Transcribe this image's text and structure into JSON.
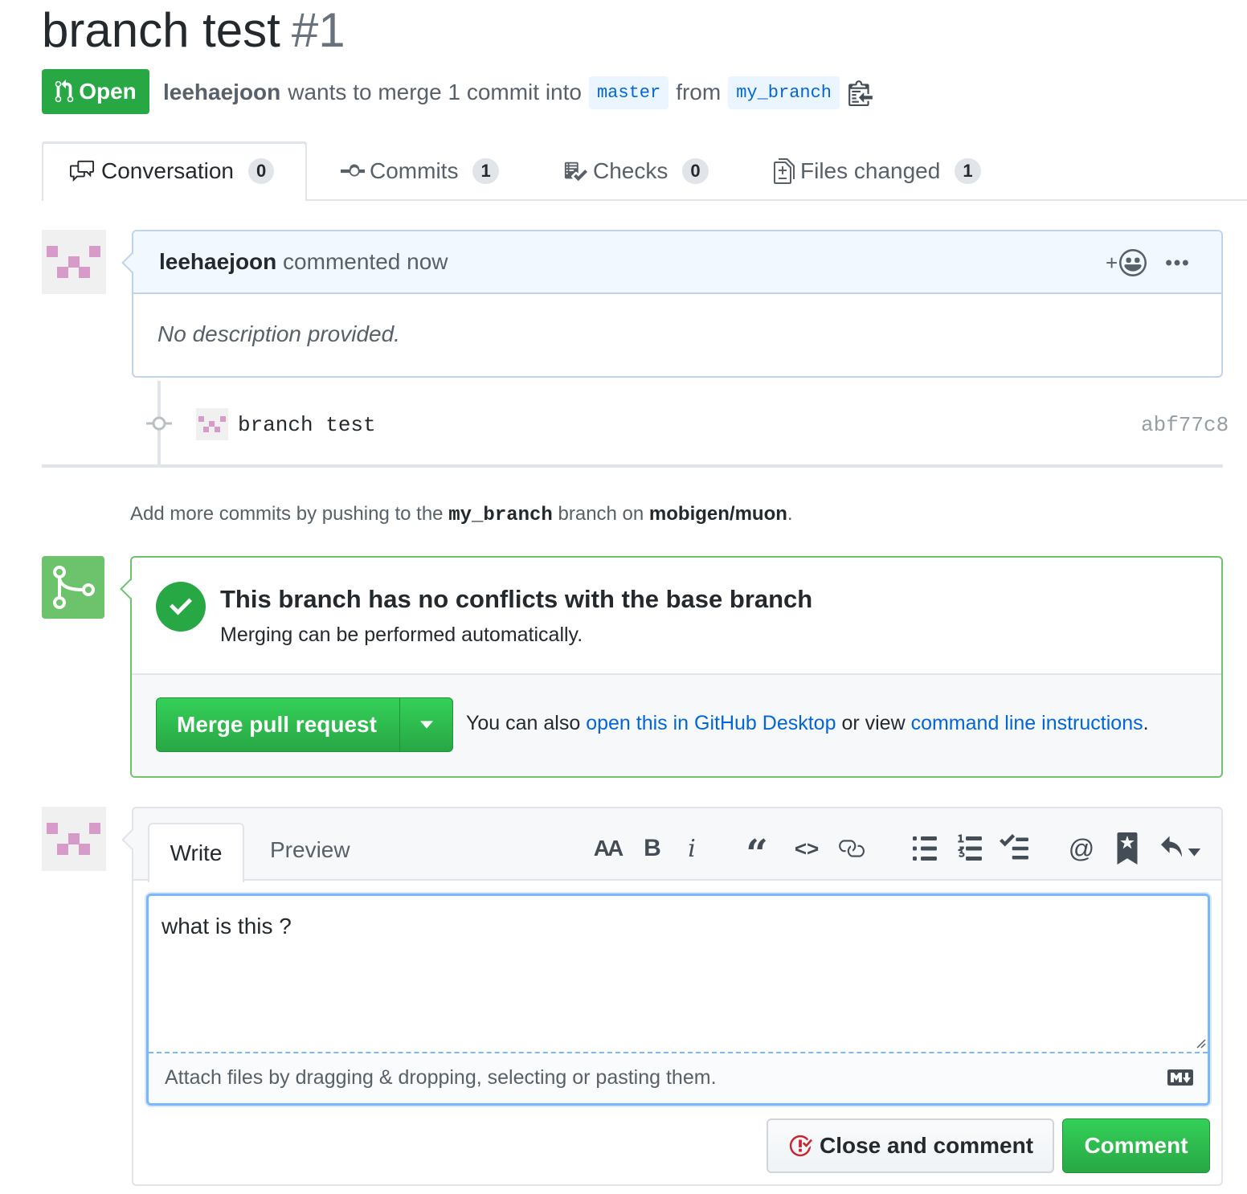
{
  "pr": {
    "title": "branch test",
    "number": "#1",
    "state": "Open",
    "author": "leehaejoon",
    "merge_text": "wants to merge 1 commit into",
    "base_branch": "master",
    "from_text": "from",
    "head_branch": "my_branch"
  },
  "tabs": [
    {
      "label": "Conversation",
      "count": "0",
      "icon": "comment-discussion-icon"
    },
    {
      "label": "Commits",
      "count": "1",
      "icon": "git-commit-icon"
    },
    {
      "label": "Checks",
      "count": "0",
      "icon": "checklist-icon"
    },
    {
      "label": "Files changed",
      "count": "1",
      "icon": "diff-icon"
    }
  ],
  "comment": {
    "author": "leehaejoon",
    "action": "commented now",
    "body": "No description provided.",
    "reaction_plus": "+"
  },
  "commit": {
    "message": "branch test",
    "sha": "abf77c8"
  },
  "push_hint": {
    "prefix": "Add more commits by pushing to the",
    "branch": "my_branch",
    "middle": "branch on",
    "repo": "mobigen/muon",
    "suffix": "."
  },
  "merge": {
    "title": "This branch has no conflicts with the base branch",
    "subtitle": "Merging can be performed automatically.",
    "button": "Merge pull request",
    "alt_prefix": "You can also",
    "alt_link1": "open this in GitHub Desktop",
    "alt_middle": "or view",
    "alt_link2": "command line instructions",
    "alt_suffix": ".",
    "colors": {
      "green": "#28a745",
      "link": "#0366d6"
    }
  },
  "new_comment": {
    "tab_write": "Write",
    "tab_preview": "Preview",
    "toolbar": {
      "header": "AA",
      "bold": "B",
      "italic": "i",
      "quote": "“",
      "code": "<>",
      "mention": "@"
    },
    "value": "what is this ?",
    "attach_hint": "Attach files by dragging & dropping, selecting or pasting them.",
    "close_button": "Close and comment",
    "comment_button": "Comment"
  }
}
